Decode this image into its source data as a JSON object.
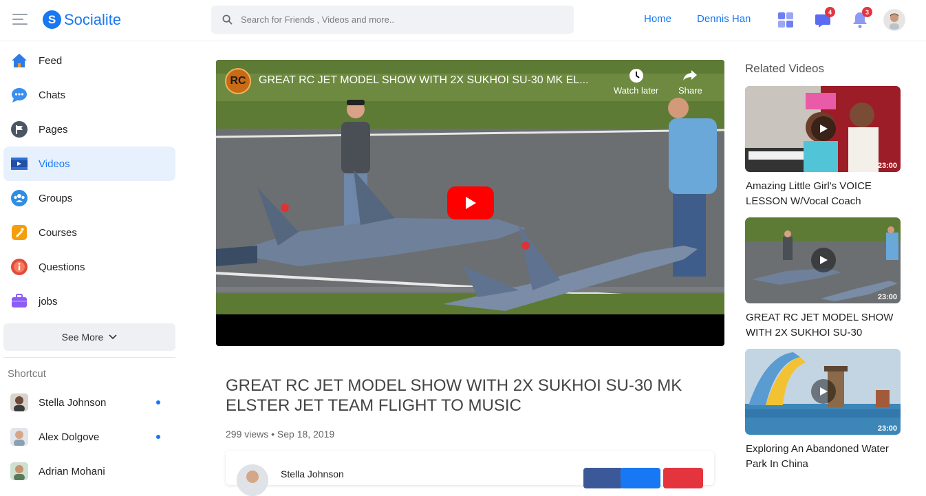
{
  "header": {
    "logo_letter": "S",
    "logo_text": "Socialite",
    "search_placeholder": "Search for Friends , Videos and more..",
    "nav_home": "Home",
    "nav_user": "Dennis Han",
    "messages_badge": "4",
    "notifications_badge": "3"
  },
  "sidebar": {
    "items": [
      {
        "label": "Feed",
        "icon": "home-icon"
      },
      {
        "label": "Chats",
        "icon": "chat-icon"
      },
      {
        "label": "Pages",
        "icon": "flag-icon"
      },
      {
        "label": "Videos",
        "icon": "video-icon",
        "active": true
      },
      {
        "label": "Groups",
        "icon": "groups-icon"
      },
      {
        "label": "Courses",
        "icon": "courses-icon"
      },
      {
        "label": "Questions",
        "icon": "question-icon"
      },
      {
        "label": "jobs",
        "icon": "briefcase-icon"
      }
    ],
    "see_more": "See More",
    "shortcut_title": "Shortcut",
    "shortcuts": [
      {
        "name": "Stella Johnson",
        "online": true
      },
      {
        "name": "Alex Dolgove",
        "online": true
      },
      {
        "name": "Adrian Mohani",
        "online": false
      }
    ]
  },
  "video": {
    "channel_logo": "RC",
    "player_title": "GREAT RC JET MODEL SHOW WITH 2X SUKHOI SU-30 MK EL...",
    "watch_later": "Watch later",
    "share": "Share",
    "title": "GREAT RC JET MODEL SHOW WITH 2X SUKHOI SU-30 MK ELSTER JET TEAM FLIGHT TO MUSIC",
    "meta": "299 views • Sep 18, 2019",
    "author": "Stella Johnson"
  },
  "related": {
    "heading": "Related Videos",
    "items": [
      {
        "title": "Amazing Little Girl's VOICE LESSON W/Vocal Coach",
        "duration": "23:00"
      },
      {
        "title": "GREAT RC JET MODEL SHOW WITH 2X SUKHOI SU-30",
        "duration": "23:00"
      },
      {
        "title": "Exploring An Abandoned Water Park In China",
        "duration": "23:00"
      }
    ]
  },
  "colors": {
    "accent": "#1877f2",
    "badge": "#e4343d",
    "youtube_red": "#ff0000"
  }
}
